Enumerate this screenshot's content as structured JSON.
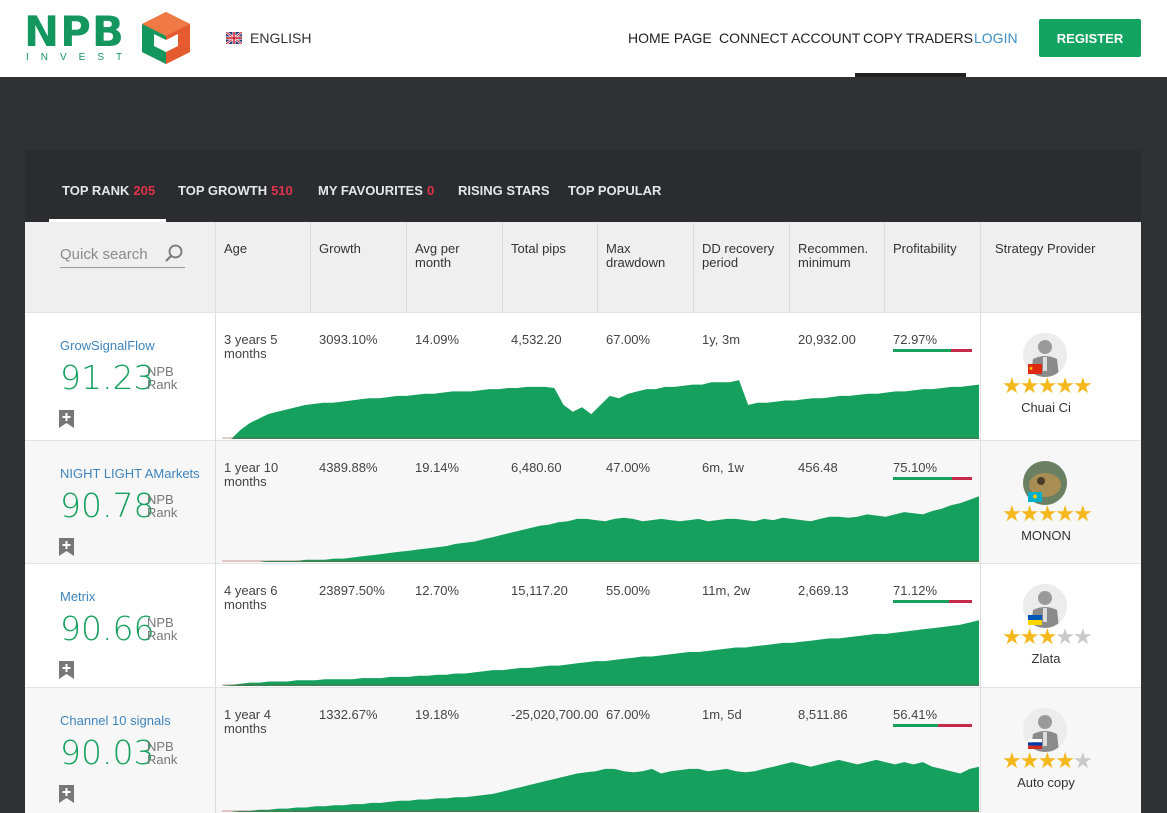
{
  "header": {
    "logo_text": "NPB",
    "logo_sub": "INVEST",
    "language": "ENGLISH",
    "nav": [
      "HOME PAGE",
      "CONNECT ACCOUNT",
      "COPY TRADERS",
      "LOGIN"
    ],
    "register": "REGISTER",
    "colors": {
      "brand": "#14965f",
      "login": "#3c8fc6",
      "register": "#14a461"
    }
  },
  "tabs": [
    {
      "label": "TOP RANK",
      "count": "205"
    },
    {
      "label": "TOP GROWTH",
      "count": "510"
    },
    {
      "label": "MY FAVOURITES",
      "count": "0"
    },
    {
      "label": "RISING STARS",
      "count": ""
    },
    {
      "label": "TOP POPULAR",
      "count": ""
    }
  ],
  "search": {
    "placeholder": "Quick search",
    "icon": "search-icon"
  },
  "columns": {
    "age": "Age",
    "growth": "Growth",
    "avg_l1": "Avg per",
    "avg_l2": "month",
    "pips": "Total pips",
    "dd_l1": "Max",
    "dd_l2": "drawdown",
    "rec_l1": "DD recovery",
    "rec_l2": "period",
    "min_l1": "Recommen.",
    "min_l2": "minimum",
    "profit": "Profitability",
    "provider": "Strategy Provider"
  },
  "rank_label_1": "NPB",
  "rank_label_2": "Rank",
  "rows": [
    {
      "name": "GrowSignalFlow",
      "score": "91.23",
      "age_1": "3 years 5",
      "age_2": "months",
      "growth": "3093.10%",
      "avg": "14.09%",
      "pips": "4,532.20",
      "drawdown": "67.00%",
      "recovery": "1y, 3m",
      "minimum": "20,932.00",
      "profit": "72.97%",
      "profit_value": 72.97,
      "provider": "Chuai Ci",
      "stars": 5,
      "flag": "china",
      "chart": [
        0,
        0,
        8,
        14,
        18,
        22,
        24,
        26,
        28,
        30,
        31,
        32,
        32,
        33,
        34,
        35,
        36,
        36,
        37,
        38,
        38,
        39,
        40,
        40,
        41,
        42,
        42,
        42,
        43,
        44,
        44,
        45,
        45,
        46,
        46,
        46,
        45,
        30,
        24,
        28,
        22,
        30,
        38,
        36,
        40,
        42,
        44,
        44,
        46,
        46,
        47,
        48,
        48,
        50,
        50,
        50,
        52,
        30,
        32,
        32,
        33,
        34,
        34,
        35,
        36,
        36,
        37,
        38,
        38,
        39,
        40,
        40,
        41,
        42,
        42,
        43,
        44,
        44,
        45,
        46,
        46,
        47,
        48
      ]
    },
    {
      "name": "NIGHT LIGHT AMarkets",
      "score": "90.78",
      "age_1": "1 year 10",
      "age_2": "months",
      "growth": "4389.88%",
      "avg": "19.14%",
      "pips": "6,480.60",
      "drawdown": "47.00%",
      "recovery": "6m, 1w",
      "minimum": "456.48",
      "profit": "75.10%",
      "profit_value": 75.1,
      "provider": "MONON",
      "stars": 5,
      "flag": "kazakhstan",
      "chart": [
        0,
        0,
        0,
        0,
        0,
        1,
        1,
        1,
        1,
        2,
        2,
        2,
        3,
        3,
        4,
        5,
        6,
        7,
        8,
        9,
        10,
        11,
        12,
        13,
        14,
        16,
        17,
        18,
        20,
        22,
        24,
        26,
        28,
        30,
        32,
        33,
        35,
        36,
        38,
        38,
        37,
        36,
        38,
        39,
        38,
        36,
        37,
        38,
        37,
        36,
        37,
        38,
        36,
        37,
        38,
        38,
        37,
        36,
        38,
        37,
        39,
        38,
        37,
        36,
        38,
        40,
        40,
        39,
        40,
        42,
        41,
        40,
        42,
        44,
        43,
        42,
        45,
        47,
        50,
        52,
        55,
        58
      ]
    },
    {
      "name": "Metrix",
      "score": "90.66",
      "age_1": "4 years 6",
      "age_2": "months",
      "growth": "23897.50%",
      "avg": "12.70%",
      "pips": "15,117.20",
      "drawdown": "55.00%",
      "recovery": "11m, 2w",
      "minimum": "2,669.13",
      "profit": "71.12%",
      "profit_value": 71.12,
      "provider": "Zlata",
      "stars": 3,
      "flag": "ukraine",
      "chart": [
        0,
        1,
        2,
        3,
        3,
        4,
        4,
        4,
        5,
        5,
        5,
        6,
        6,
        6,
        6,
        7,
        7,
        7,
        8,
        8,
        8,
        9,
        9,
        10,
        10,
        11,
        11,
        12,
        13,
        14,
        14,
        15,
        16,
        16,
        17,
        18,
        18,
        19,
        20,
        21,
        22,
        22,
        23,
        24,
        25,
        26,
        26,
        27,
        28,
        29,
        30,
        30,
        31,
        32,
        33,
        34,
        34,
        35,
        36,
        37,
        38,
        38,
        39,
        40,
        41,
        42,
        42,
        43,
        44,
        45,
        46,
        46,
        47,
        48,
        49,
        50,
        51,
        52,
        53,
        54,
        56,
        58
      ]
    },
    {
      "name": "Channel 10 signals",
      "score": "90.03",
      "age_1": "1 year 4",
      "age_2": "months",
      "growth": "1332.67%",
      "avg": "19.18%",
      "pips": "-25,020,700.00",
      "drawdown": "67.00%",
      "recovery": "1m, 5d",
      "minimum": "8,511.86",
      "profit": "56.41%",
      "profit_value": 56.41,
      "provider": "Auto copy",
      "stars": 4,
      "flag": "russia",
      "chart": [
        0,
        0,
        1,
        1,
        2,
        2,
        3,
        3,
        4,
        4,
        5,
        5,
        6,
        6,
        7,
        7,
        8,
        8,
        9,
        10,
        10,
        11,
        11,
        12,
        12,
        13,
        13,
        14,
        15,
        16,
        18,
        20,
        22,
        24,
        26,
        28,
        30,
        32,
        34,
        35,
        36,
        38,
        38,
        36,
        35,
        36,
        38,
        34,
        36,
        37,
        38,
        38,
        36,
        37,
        38,
        36,
        35,
        36,
        38,
        40,
        42,
        44,
        42,
        40,
        42,
        44,
        46,
        44,
        42,
        44,
        46,
        44,
        42,
        44,
        42,
        44,
        40,
        38,
        36,
        34,
        38,
        40
      ]
    }
  ]
}
